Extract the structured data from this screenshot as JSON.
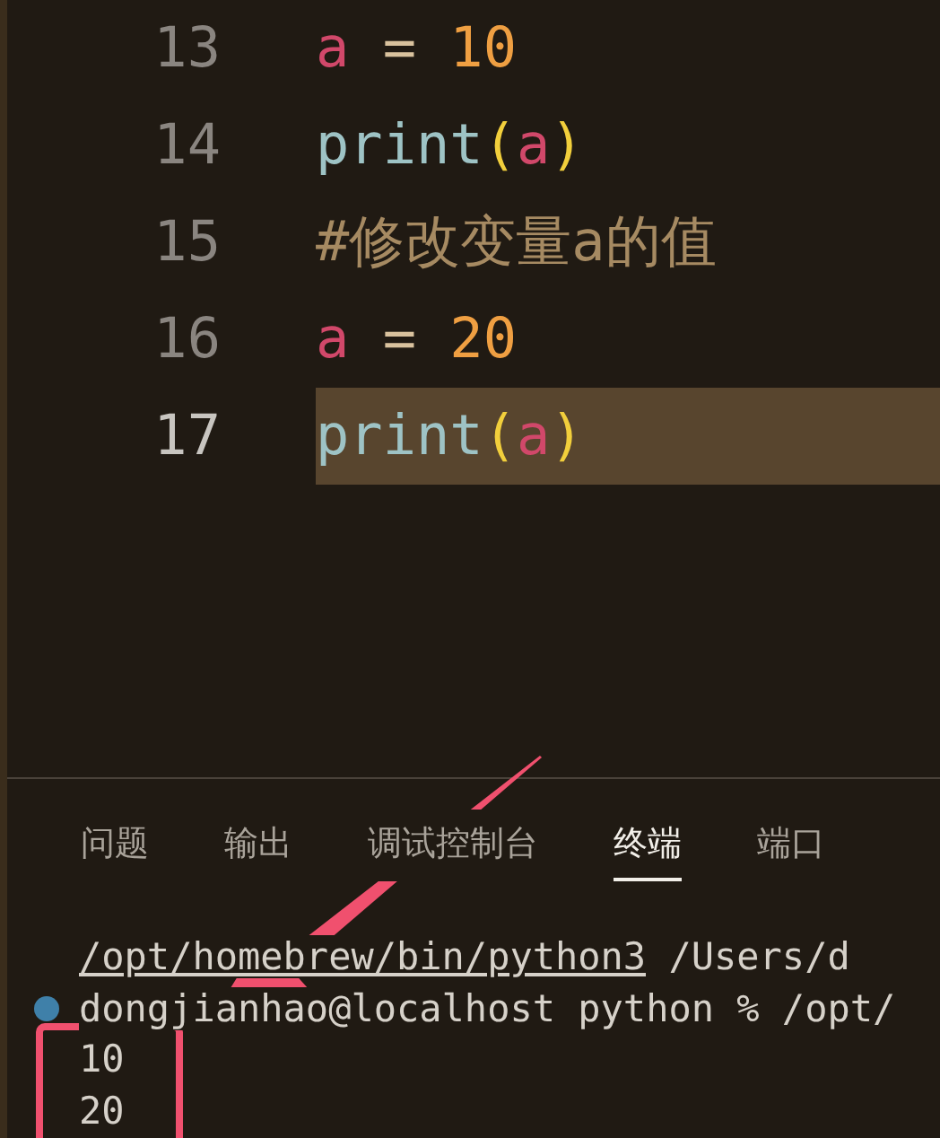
{
  "editor": {
    "lines": [
      {
        "number": "13",
        "current": false,
        "tokens": [
          {
            "kind": "variable",
            "text": "a"
          },
          {
            "kind": "operator",
            "text": " = "
          },
          {
            "kind": "number",
            "text": "10"
          }
        ]
      },
      {
        "number": "14",
        "current": false,
        "tokens": [
          {
            "kind": "function",
            "text": "print"
          },
          {
            "kind": "bracket",
            "text": "("
          },
          {
            "kind": "variable",
            "text": "a"
          },
          {
            "kind": "bracket",
            "text": ")"
          }
        ]
      },
      {
        "number": "15",
        "current": false,
        "tokens": [
          {
            "kind": "comment",
            "text": "#修改变量a的值"
          }
        ]
      },
      {
        "number": "16",
        "current": false,
        "tokens": [
          {
            "kind": "variable",
            "text": "a"
          },
          {
            "kind": "operator",
            "text": " = "
          },
          {
            "kind": "number",
            "text": "20"
          }
        ]
      },
      {
        "number": "17",
        "current": true,
        "tokens": [
          {
            "kind": "function",
            "text": "print"
          },
          {
            "kind": "bracket",
            "text": "("
          },
          {
            "kind": "variable",
            "text": "a"
          },
          {
            "kind": "bracket",
            "text": ")"
          }
        ]
      }
    ]
  },
  "panel": {
    "tabs": [
      {
        "label": "问题",
        "selected": false
      },
      {
        "label": "输出",
        "selected": false
      },
      {
        "label": "调试控制台",
        "selected": false
      },
      {
        "label": "终端",
        "selected": true
      },
      {
        "label": "端口",
        "selected": false
      }
    ],
    "terminal": {
      "lines": [
        {
          "kind": "command",
          "text": "/opt/homebrew/bin/python3",
          "rest": " /Users/d"
        },
        {
          "kind": "prompt",
          "text": "dongjianhao@localhost python % /opt/"
        },
        {
          "kind": "output",
          "text": "10"
        },
        {
          "kind": "output",
          "text": "20"
        }
      ]
    }
  }
}
